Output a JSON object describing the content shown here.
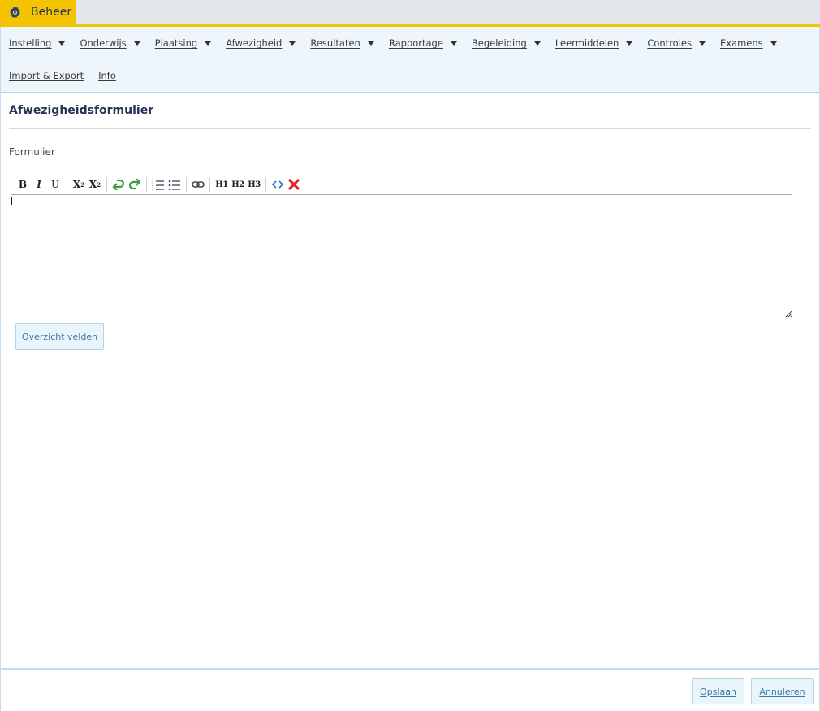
{
  "app": {
    "tab_label": "Beheer"
  },
  "menu": {
    "row1": [
      {
        "label": "Instelling"
      },
      {
        "label": "Onderwijs"
      },
      {
        "label": "Plaatsing"
      },
      {
        "label": "Afwezigheid"
      },
      {
        "label": "Resultaten"
      },
      {
        "label": "Rapportage"
      },
      {
        "label": "Begeleiding"
      },
      {
        "label": "Leermiddelen"
      },
      {
        "label": "Controles"
      },
      {
        "label": "Examens"
      }
    ],
    "row2": [
      {
        "label": "Import & Export"
      },
      {
        "label": "Info"
      }
    ]
  },
  "page": {
    "title": "Afwezigheidsformulier",
    "section_label": "Formulier"
  },
  "toolbar": {
    "bold": "B",
    "italic": "I",
    "underline": "U",
    "subscript": "X",
    "superscript": "X",
    "h1": "H1",
    "h2": "H2",
    "h3": "H3"
  },
  "buttons": {
    "overzicht": "Overzicht velden",
    "save": "Opslaan",
    "cancel": "Annuleren"
  },
  "colors": {
    "accent": "#f5c400",
    "menu_bg": "#eef6fc",
    "link": "#3878ad",
    "title": "#243554"
  },
  "icons": [
    "gear-icon",
    "bold-icon",
    "italic-icon",
    "underline-icon",
    "subscript-icon",
    "superscript-icon",
    "undo-icon",
    "redo-icon",
    "ordered-list-icon",
    "unordered-list-icon",
    "link-icon",
    "h1-icon",
    "h2-icon",
    "h3-icon",
    "code-icon",
    "remove-format-icon",
    "resize-handle-icon"
  ]
}
